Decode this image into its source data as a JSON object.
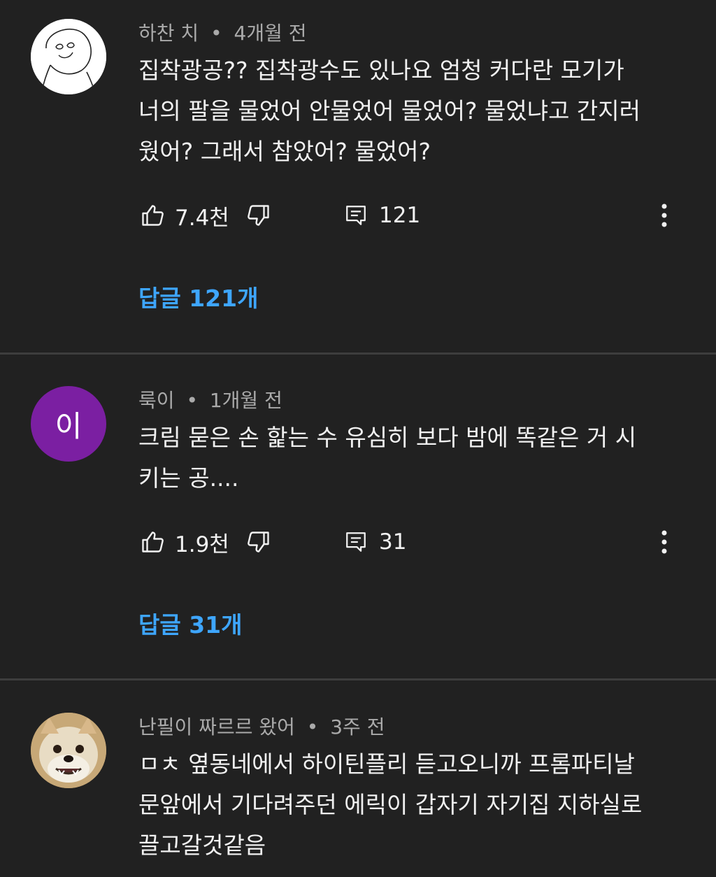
{
  "comments": [
    {
      "author": "하찬 치",
      "time": "4개월 전",
      "text_lines": [
        "집착광공?? 집착광수도 있나요 엄청 커다란 모기가",
        "너의 팔을 물었어 안물었어 물었어? 물었냐고 간지러",
        "웠어? 그래서 참았어? 물었어?"
      ],
      "likes": "7.4천",
      "reply_count": "121",
      "replies_label": "답글 121개"
    },
    {
      "author": "룩이",
      "time": "1개월 전",
      "avatar_letter": "이",
      "avatar_color": "#7b1fa2",
      "text_lines": [
        "크림 묻은 손 핥는 수 유심히 보다 밤에 똑같은 거 시",
        "키는 공...."
      ],
      "likes": "1.9천",
      "reply_count": "31",
      "replies_label": "답글 31개"
    },
    {
      "author": "난필이 짜르르 왔어",
      "time": "3주 전",
      "text_lines": [
        "ㅁㅊ 옆동네에서 하이틴플리 듣고오니까 프롬파티날",
        "문앞에서 기다려주던 에릭이 갑자기 자기집 지하실로",
        "끌고갈것같음"
      ]
    }
  ],
  "separator": "•",
  "colors": {
    "background": "#212121",
    "link": "#3ea6ff",
    "meta": "#aaaaaa",
    "divider": "#3d3d3d"
  },
  "icons": [
    "like-icon",
    "dislike-icon",
    "reply-icon",
    "more-icon"
  ]
}
